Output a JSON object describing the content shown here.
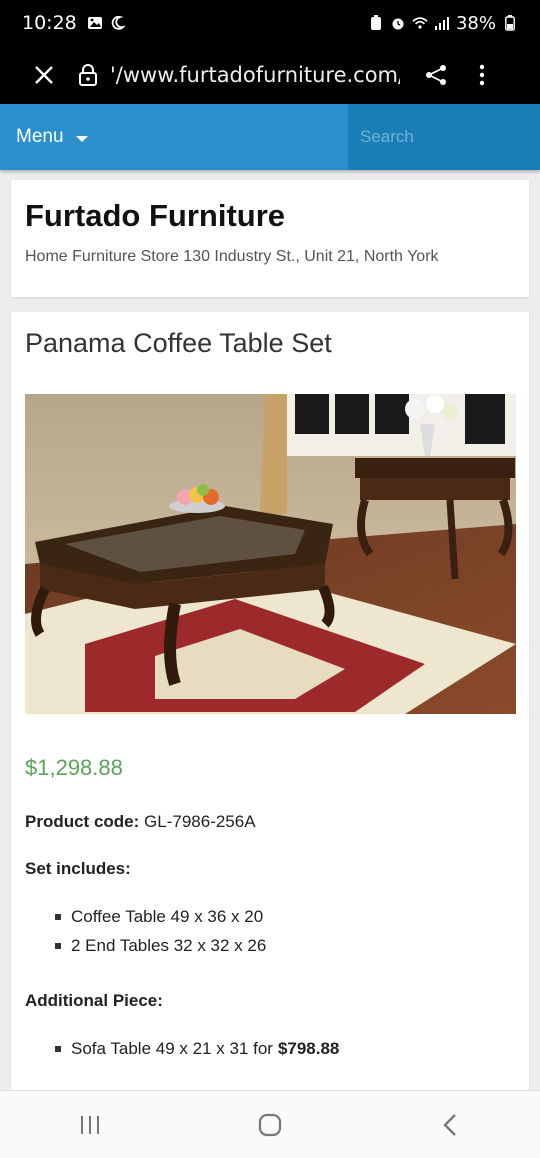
{
  "status": {
    "time": "10:28",
    "battery": "38%"
  },
  "browser": {
    "url": "'/www.furtadofurniture.com/p"
  },
  "nav": {
    "menu_label": "Menu",
    "search_placeholder": "Search"
  },
  "site": {
    "title": "Furtado Furniture",
    "subtitle": "Home Furniture Store 130 Industry St., Unit 21, North York"
  },
  "product": {
    "title": "Panama Coffee Table Set",
    "price": "$1,298.88",
    "code_label": "Product code:",
    "code_value": "GL-7986-256A",
    "set_label": "Set includes:",
    "set_items": [
      "Coffee Table 49 x 36 x 20",
      "2 End Tables 32 x 32 x 26"
    ],
    "additional_label": "Additional Piece:",
    "additional_item_text": "Sofa Table 49 x 21 x 31 for",
    "additional_item_price": "$798.88"
  },
  "colors": {
    "nav_blue": "#2a8fcb",
    "search_blue": "#1a7db4",
    "price_green": "#5aa55a"
  },
  "icons": [
    "image-icon",
    "moon-icon",
    "battery-saver-icon",
    "alarm-icon",
    "wifi-icon",
    "signal-icon",
    "battery-icon",
    "close-icon",
    "lock-icon",
    "share-icon",
    "more-icon",
    "recents-icon",
    "home-icon",
    "back-icon"
  ]
}
